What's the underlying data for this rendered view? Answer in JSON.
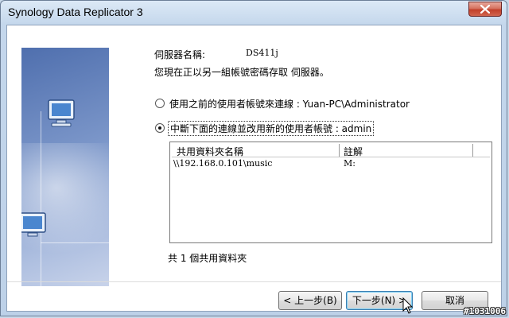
{
  "window": {
    "title": "Synology Data Replicator 3"
  },
  "server": {
    "name_label": "伺服器名稱:",
    "name_value": "DS411j",
    "notice": "您現在正以另一組帳號密碼存取 伺服器。"
  },
  "options": [
    {
      "label": "使用之前的使用者帳號來連線 : Yuan-PC\\Administrator",
      "selected": false
    },
    {
      "label": "中斷下面的連線並改用新的使用者帳號 : admin",
      "selected": true
    }
  ],
  "table": {
    "columns": [
      "共用資料夾名稱",
      "註解"
    ],
    "rows": [
      {
        "folder": "\\\\192.168.0.101\\music",
        "comment": "M:"
      }
    ]
  },
  "summary": "共 1 個共用資料夾",
  "buttons": {
    "back": "< 上一步(B)",
    "next": "下一步(N) >",
    "cancel": "取消"
  },
  "watermark": "#1031006",
  "colors": {
    "close_red": "#c2402a",
    "panel_blue": "#4f6fae"
  }
}
